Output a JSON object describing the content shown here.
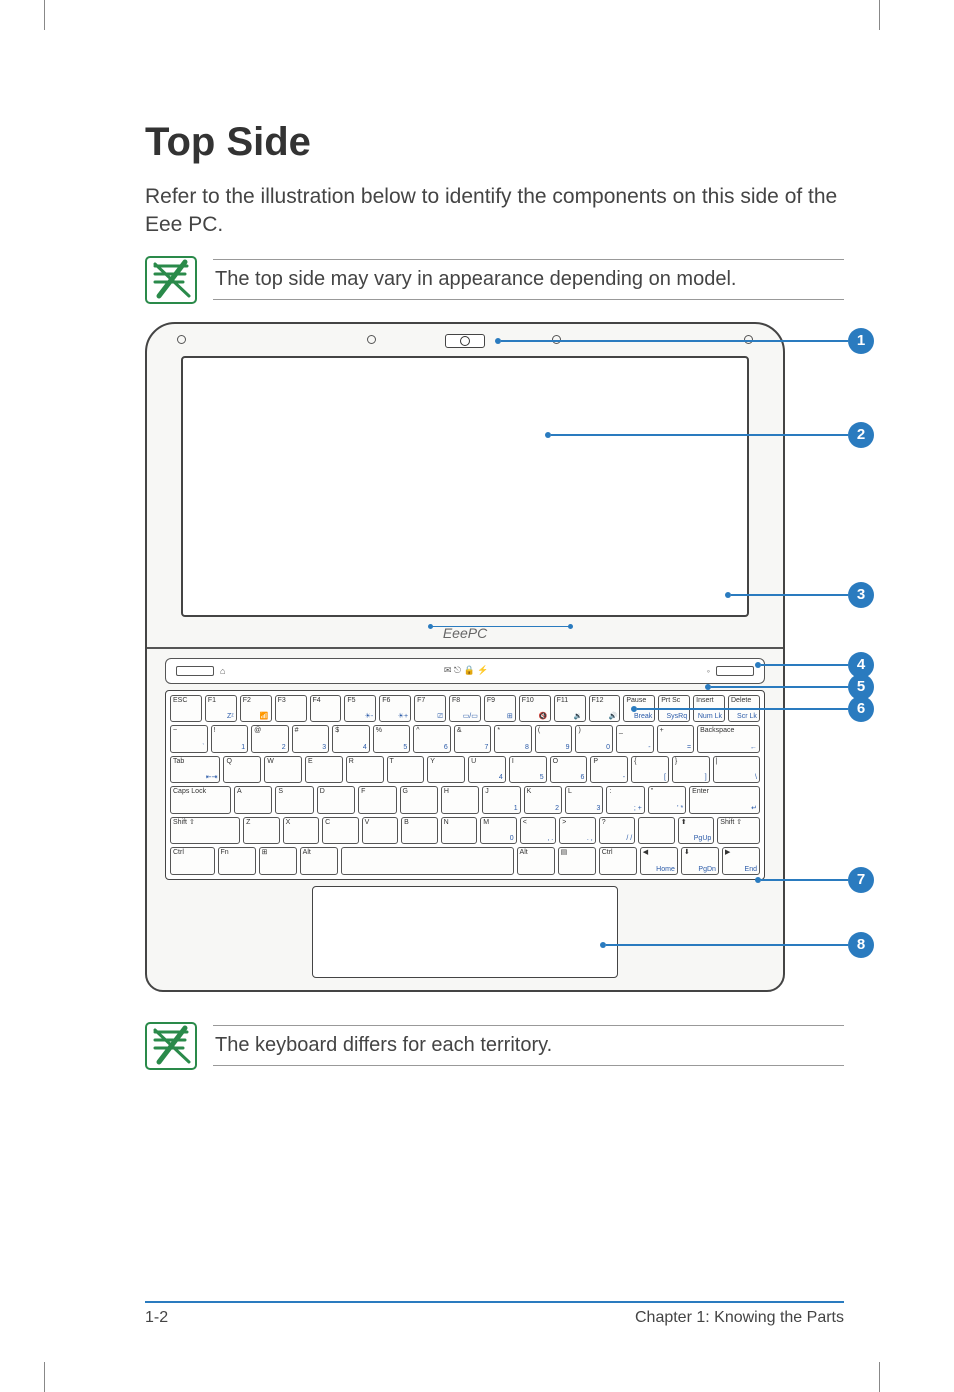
{
  "heading": "Top Side",
  "intro": "Refer to the illustration below to identify the components on this side of the Eee PC.",
  "note_top": "The top side may vary in appearance depending on model.",
  "note_bottom": "The keyboard differs for each territory.",
  "brand": "EeePC",
  "status_bar": {
    "left_icons": "⌂",
    "mid_icons": "✉  ⎋  🔒  ⚡",
    "right_icons": "◦"
  },
  "callouts": [
    "1",
    "2",
    "3",
    "4",
    "5",
    "6",
    "7",
    "8"
  ],
  "keyboard": {
    "row1": [
      {
        "t": "ESC",
        "b": ""
      },
      {
        "t": "F1",
        "b": "Zᶻ"
      },
      {
        "t": "F2",
        "b": "📶"
      },
      {
        "t": "F3",
        "b": ""
      },
      {
        "t": "F4",
        "b": ""
      },
      {
        "t": "F5",
        "b": "☀-"
      },
      {
        "t": "F6",
        "b": "☀+"
      },
      {
        "t": "F7",
        "b": "⎚"
      },
      {
        "t": "F8",
        "b": "▭/▭"
      },
      {
        "t": "F9",
        "b": "⊞"
      },
      {
        "t": "F10",
        "b": "🔇"
      },
      {
        "t": "F11",
        "b": "🔉"
      },
      {
        "t": "F12",
        "b": "🔊"
      },
      {
        "t": "Pause",
        "b": "Break"
      },
      {
        "t": "Prt Sc",
        "b": "SysRq"
      },
      {
        "t": "Insert",
        "b": "Num Lk"
      },
      {
        "t": "Delete",
        "b": "Scr Lk"
      }
    ],
    "row2": [
      {
        "t": "~",
        "b": "`"
      },
      {
        "t": "!",
        "b": "1"
      },
      {
        "t": "@",
        "b": "2"
      },
      {
        "t": "#",
        "b": "3"
      },
      {
        "t": "$",
        "b": "4"
      },
      {
        "t": "%",
        "b": "5"
      },
      {
        "t": "^",
        "b": "6"
      },
      {
        "t": "&",
        "b": "7"
      },
      {
        "t": "*",
        "b": "8"
      },
      {
        "t": "(",
        "b": "9"
      },
      {
        "t": ")",
        "b": "0"
      },
      {
        "t": "_",
        "b": "-"
      },
      {
        "t": "+",
        "b": "="
      },
      {
        "t": "Backspace",
        "b": "←",
        "w": 1.8
      }
    ],
    "row3": [
      {
        "t": "Tab",
        "b": "⇤⇥",
        "w": 1.4
      },
      {
        "t": "Q",
        "b": ""
      },
      {
        "t": "W",
        "b": ""
      },
      {
        "t": "E",
        "b": ""
      },
      {
        "t": "R",
        "b": ""
      },
      {
        "t": "T",
        "b": ""
      },
      {
        "t": "Y",
        "b": ""
      },
      {
        "t": "U",
        "b": "4"
      },
      {
        "t": "I",
        "b": "5"
      },
      {
        "t": "O",
        "b": "6"
      },
      {
        "t": "P",
        "b": "-"
      },
      {
        "t": "{",
        "b": "["
      },
      {
        "t": "}",
        "b": "]"
      },
      {
        "t": "|",
        "b": "\\",
        "w": 1.3
      }
    ],
    "row4": [
      {
        "t": "Caps Lock",
        "b": "",
        "w": 1.7
      },
      {
        "t": "A",
        "b": ""
      },
      {
        "t": "S",
        "b": ""
      },
      {
        "t": "D",
        "b": ""
      },
      {
        "t": "F",
        "b": ""
      },
      {
        "t": "G",
        "b": ""
      },
      {
        "t": "H",
        "b": ""
      },
      {
        "t": "J",
        "b": "1"
      },
      {
        "t": "K",
        "b": "2"
      },
      {
        "t": "L",
        "b": "3"
      },
      {
        "t": ":",
        "b": "; +"
      },
      {
        "t": "\"",
        "b": "' *"
      },
      {
        "t": "Enter",
        "b": "↵",
        "w": 2.0
      }
    ],
    "row5": [
      {
        "t": "Shift ⇧",
        "b": "",
        "w": 2.1
      },
      {
        "t": "Z",
        "b": ""
      },
      {
        "t": "X",
        "b": ""
      },
      {
        "t": "C",
        "b": ""
      },
      {
        "t": "V",
        "b": ""
      },
      {
        "t": "B",
        "b": ""
      },
      {
        "t": "N",
        "b": ""
      },
      {
        "t": "M",
        "b": "0"
      },
      {
        "t": "<",
        "b": ", ."
      },
      {
        "t": ">",
        "b": ". ,"
      },
      {
        "t": "?",
        "b": "/ /"
      },
      {
        "t": "",
        "b": ""
      },
      {
        "t": "⬆",
        "b": "PgUp"
      },
      {
        "t": "Shift ⇧",
        "b": "",
        "w": 1.2
      }
    ],
    "row6": [
      {
        "t": "Ctrl",
        "b": "",
        "w": 1.2
      },
      {
        "t": "Fn",
        "b": ""
      },
      {
        "t": "⊞",
        "b": ""
      },
      {
        "t": "Alt",
        "b": ""
      },
      {
        "t": "",
        "b": "",
        "w": 5.2
      },
      {
        "t": "Alt",
        "b": ""
      },
      {
        "t": "▤",
        "b": ""
      },
      {
        "t": "Ctrl",
        "b": ""
      },
      {
        "t": "◀",
        "b": "Home"
      },
      {
        "t": "⬇",
        "b": "PgDn"
      },
      {
        "t": "▶",
        "b": "End"
      }
    ]
  },
  "footer": {
    "left": "1-2",
    "right": "Chapter 1: Knowing the Parts"
  }
}
